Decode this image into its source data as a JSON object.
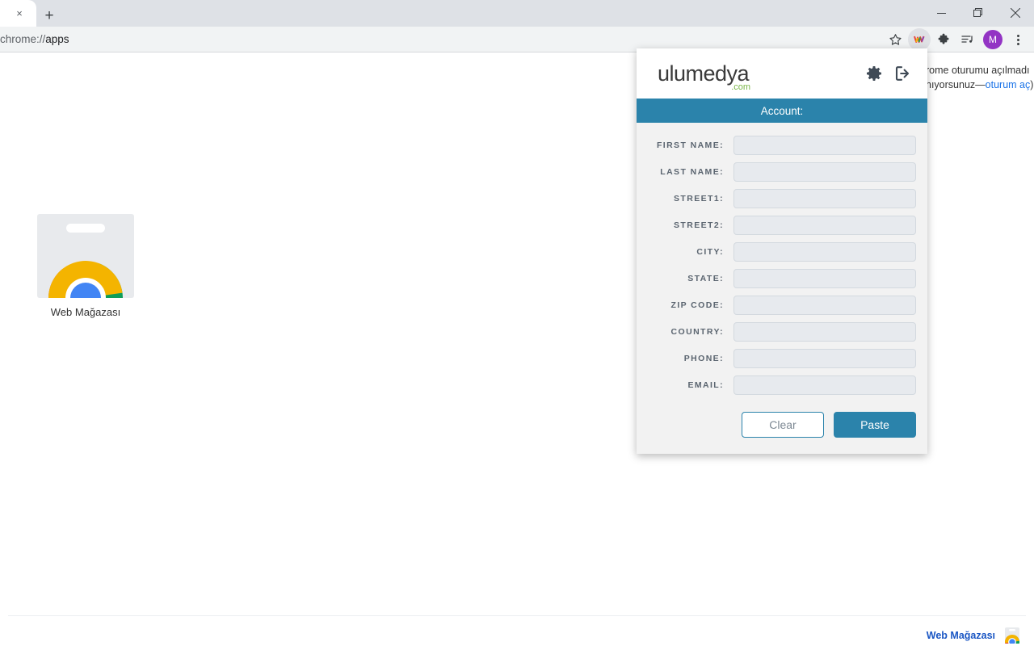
{
  "browser": {
    "tab_close_glyph": "×",
    "new_tab_glyph": "+",
    "url_scheme": "chrome://",
    "url_path": "apps",
    "window_controls": [
      {
        "name": "minimize"
      },
      {
        "name": "restore"
      },
      {
        "name": "close"
      }
    ],
    "toolbar_icons": [
      {
        "name": "bookmark-star-icon"
      },
      {
        "name": "ulumedya-extension-icon"
      },
      {
        "name": "extensions-puzzle-icon"
      },
      {
        "name": "media-playlist-icon"
      },
      {
        "name": "profile-avatar",
        "label": "M"
      },
      {
        "name": "chrome-menu-icon"
      }
    ]
  },
  "page": {
    "signin_note_line1": "rome oturumu açılmadı",
    "signin_note_line2_pre": "nıyorsunuz—",
    "signin_note_link": "oturum aç",
    "signin_note_line2_post": ")",
    "app_tile_label": "Web Mağazası",
    "store_link_label": "Web Mağazası"
  },
  "popup": {
    "logo_word": "ulumedya",
    "logo_dotcom": ".com",
    "settings_icon": "gear-icon",
    "logout_icon": "logout-icon",
    "account_bar_title": "Account:",
    "fields": [
      {
        "label": "FIRST NAME:",
        "value": "",
        "placeholder": "",
        "name": "first-name"
      },
      {
        "label": "LAST NAME:",
        "value": "",
        "placeholder": "",
        "name": "last-name"
      },
      {
        "label": "STREET1:",
        "value": "",
        "placeholder": "",
        "name": "street1"
      },
      {
        "label": "STREET2:",
        "value": "",
        "placeholder": "",
        "name": "street2"
      },
      {
        "label": "CITY:",
        "value": "",
        "placeholder": "",
        "name": "city"
      },
      {
        "label": "STATE:",
        "value": "",
        "placeholder": "",
        "name": "state"
      },
      {
        "label": "ZIP CODE:",
        "value": "",
        "placeholder": "",
        "name": "zip-code"
      },
      {
        "label": "COUNTRY:",
        "value": "",
        "placeholder": "",
        "name": "country"
      },
      {
        "label": "PHONE:",
        "value": "",
        "placeholder": "",
        "name": "phone"
      },
      {
        "label": "EMAIL:",
        "value": "",
        "placeholder": "",
        "name": "email"
      }
    ],
    "clear_label": "Clear",
    "paste_label": "Paste"
  },
  "colors": {
    "accent_blue": "#2b83ab",
    "link_blue": "#1a73e8",
    "logo_green": "#7ab648",
    "avatar_purple": "#9334c4",
    "input_fill": "#e7eaee"
  }
}
